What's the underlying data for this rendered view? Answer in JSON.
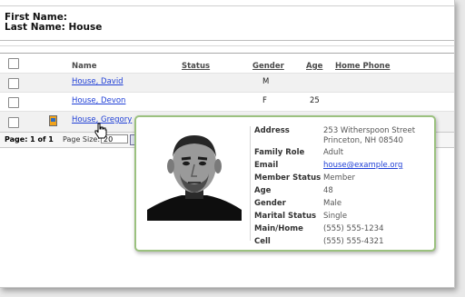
{
  "header": {
    "first_name_label": "First Name:",
    "last_name_label": "Last Name:",
    "last_name_value": "House"
  },
  "grid": {
    "columns": [
      "Name",
      "Status",
      "Gender",
      "Age",
      "Home Phone"
    ],
    "rows": [
      {
        "name": "House, David",
        "status": "",
        "gender": "M",
        "age": "",
        "phone": ""
      },
      {
        "name": "House, Devon",
        "status": "",
        "gender": "F",
        "age": "25",
        "phone": ""
      },
      {
        "name": "House, Gregory",
        "status": "",
        "gender": "",
        "age": "",
        "phone": ""
      }
    ]
  },
  "pager": {
    "page_info": "Page: 1 of 1",
    "page_size_label": "Page Size:",
    "page_size_value": "20"
  },
  "popup": {
    "address_label": "Address",
    "address_line1": "253 Witherspoon Street",
    "address_line2": "Princeton, NH 08540",
    "family_role_label": "Family Role",
    "family_role": "Adult",
    "email_label": "Email",
    "email": "house@example.org",
    "member_status_label": "Member Status",
    "member_status": "Member",
    "age_label": "Age",
    "age": "48",
    "gender_label": "Gender",
    "gender": "Male",
    "marital_status_label": "Marital Status",
    "marital_status": "Single",
    "main_home_label": "Main/Home",
    "main_home": "(555) 555-1234",
    "cell_label": "Cell",
    "cell": "(555) 555-4321"
  },
  "colors": {
    "link": "#1f3fd6",
    "popup_border": "#9bc17f"
  },
  "icons": {
    "row_icon": "person-card-icon",
    "cursor": "hand-pointer-icon"
  }
}
